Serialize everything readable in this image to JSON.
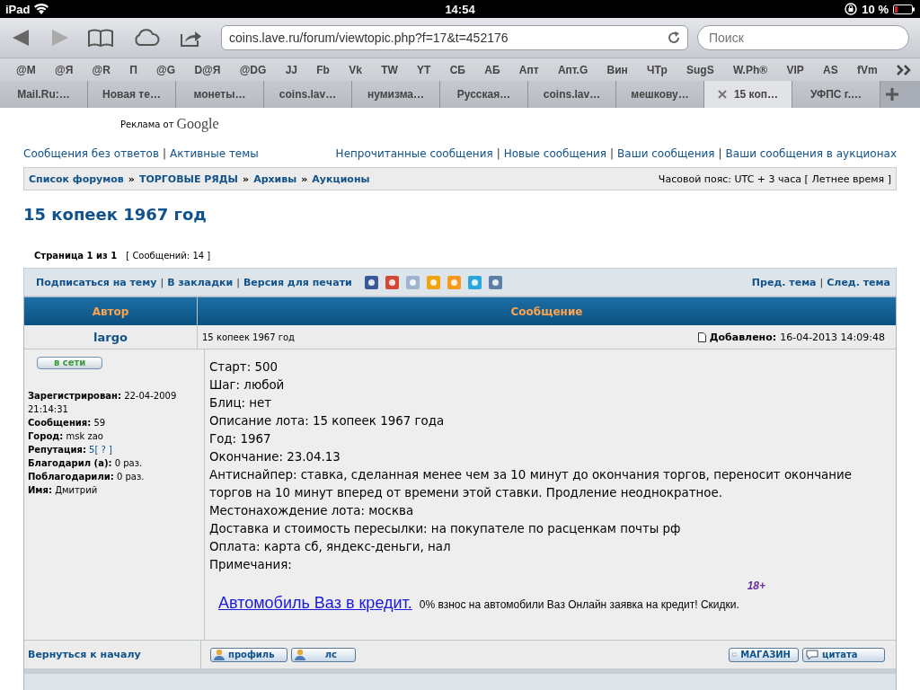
{
  "status_bar": {
    "device": "iPad",
    "time": "14:54",
    "battery": "10 %"
  },
  "browser": {
    "url": "coins.lave.ru/forum/viewtopic.php?f=17&t=452176",
    "search": {
      "placeholder": "Поиск"
    },
    "bookmarks": [
      "@M",
      "@Я",
      "@R",
      "П",
      "@G",
      "D@Я",
      "@DG",
      "JJ",
      "Fb",
      "Vk",
      "TW",
      "YT",
      "СБ",
      "АБ",
      "Апт",
      "Апт.G",
      "Вин",
      "ЧТр",
      "SugS",
      "W.Ph®",
      "VIP",
      "AS",
      "fVm"
    ],
    "tabs": [
      {
        "label": "Mail.Ru:…",
        "selected": false
      },
      {
        "label": "Новая те…",
        "selected": false
      },
      {
        "label": "монеты…",
        "selected": false
      },
      {
        "label": "coins.lav…",
        "selected": false
      },
      {
        "label": "нумизма…",
        "selected": false
      },
      {
        "label": "Русская…",
        "selected": false
      },
      {
        "label": "coins.lav…",
        "selected": false
      },
      {
        "label": "мешкову…",
        "selected": false
      },
      {
        "label": "15 коп…",
        "selected": true
      },
      {
        "label": "УФПС г.…",
        "selected": false
      }
    ]
  },
  "ad_label": {
    "text": "Реклама от",
    "brand": "Google"
  },
  "top_links_left": [
    "Сообщения без ответов",
    "Активные темы"
  ],
  "top_links_right": [
    "Непрочитанные сообщения",
    "Новые сообщения",
    "Ваши сообщения",
    "Ваши сообщения в аукционах"
  ],
  "breadcrumbs": [
    "Список форумов",
    "ТОРГОВЫЕ РЯДЫ",
    "Архивы",
    "Аукционы"
  ],
  "timezone": "Часовой пояс: UTC + 3 часа [ Летнее время ]",
  "topic_title": "15 копеек 1967 год",
  "pagination": {
    "page": "Страница 1 из 1",
    "count": "[ Сообщений: 14 ]"
  },
  "topic_actions": [
    "Подписаться на тему",
    "В закладки",
    "Версия для печати"
  ],
  "link_separator": "|",
  "breadcrumb_separator": "»",
  "topic_nav": [
    "Пред. тема",
    "След. тема"
  ],
  "table": {
    "columns": [
      "Автор",
      "Сообщение"
    ]
  },
  "post": {
    "author": "largo",
    "subject": "15 копеек 1967 год",
    "added_label": "Добавлено:",
    "added": "16-04-2013 14:09:48",
    "online": "в сети",
    "profile": [
      {
        "label": "Зарегистрирован:",
        "value": "22-04-2009 21:14:31"
      },
      {
        "label": "Сообщения:",
        "value": "59"
      },
      {
        "label": "Город:",
        "value": "msk zao"
      },
      {
        "label": "Репутация:",
        "value": "5",
        "extra": "[ ? ]"
      },
      {
        "label": "Благодарил (а):",
        "value": "0 раз."
      },
      {
        "label": "Поблагодарили:",
        "value": "0 раз."
      },
      {
        "label": "Имя:",
        "value": "Дмитрий"
      }
    ],
    "body": [
      "Старт: 500",
      "Шаг: любой",
      "Блиц: нет",
      "Описание лота: 15 копеек 1967 года",
      "Год: 1967",
      "Окончание: 23.04.13",
      "Антиснайпер: ставка, сделанная менее чем за 10 минут до окончания торгов, переносит окончание торгов на 10 минут вперед от времени этой ставки. Продление неоднократное.",
      "Местонахождение лота: москва",
      "Доставка и стоимость пересылки: на покупателе по расценкам почты рф",
      "Оплата: карта сб, яндекс-деньги, нал",
      "Примечания:"
    ],
    "ad": {
      "age": "18+",
      "link": "Автомобиль Ваз в кредит.",
      "text": "0% взнос на автомобили Ваз Онлайн заявка на кредит! Скидки."
    },
    "back_to_top": "Вернуться к началу",
    "buttons_left": [
      "профиль",
      "лс"
    ],
    "buttons_right": [
      "МАГАЗИН",
      "цитата"
    ]
  }
}
